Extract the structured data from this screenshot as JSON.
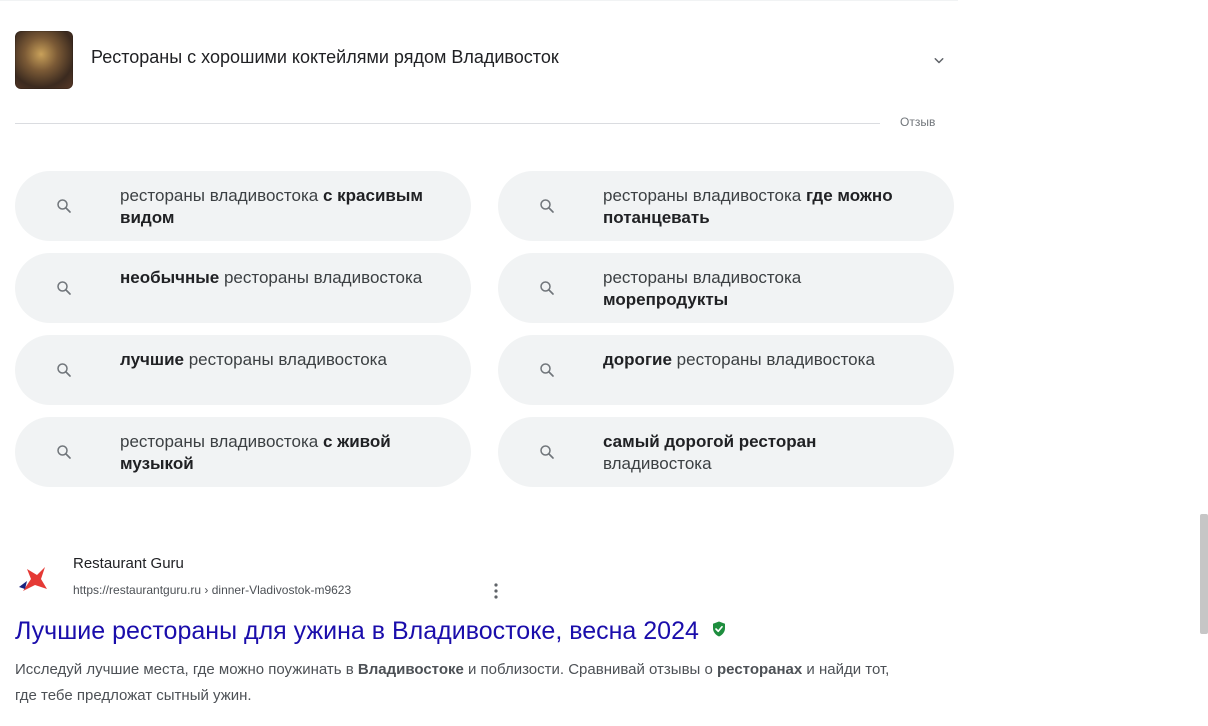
{
  "accordion": {
    "title": "Рестораны с хорошими коктейлями рядом Владивосток"
  },
  "feedback_label": "Отзыв",
  "related_searches": [
    {
      "parts": [
        {
          "text": "рестораны владивостока ",
          "bold": false
        },
        {
          "text": "с красивым видом",
          "bold": true
        }
      ]
    },
    {
      "parts": [
        {
          "text": "рестораны владивостока ",
          "bold": false
        },
        {
          "text": "где можно потанцевать",
          "bold": true
        }
      ]
    },
    {
      "parts": [
        {
          "text": "необычные",
          "bold": true
        },
        {
          "text": " рестораны владивостока",
          "bold": false
        }
      ]
    },
    {
      "parts": [
        {
          "text": "рестораны владивостока ",
          "bold": false
        },
        {
          "text": "морепродукты",
          "bold": true
        }
      ]
    },
    {
      "parts": [
        {
          "text": "лучшие",
          "bold": true
        },
        {
          "text": " рестораны владивостока",
          "bold": false
        }
      ]
    },
    {
      "parts": [
        {
          "text": "дорогие",
          "bold": true
        },
        {
          "text": " рестораны владивостока",
          "bold": false
        }
      ]
    },
    {
      "parts": [
        {
          "text": "рестораны владивостока ",
          "bold": false
        },
        {
          "text": "с живой музыкой",
          "bold": true
        }
      ]
    },
    {
      "parts": [
        {
          "text": "самый дорогой ресторан",
          "bold": true
        },
        {
          "text": " владивостока",
          "bold": false
        }
      ]
    }
  ],
  "result": {
    "site_name": "Restaurant Guru",
    "url": "https://restaurantguru.ru › dinner-Vladivostok-m9623",
    "title": "Лучшие рестораны для ужина в Владивостоке, весна 2024",
    "snippet_parts": [
      {
        "text": "Исследуй лучшие места, где можно поужинать в ",
        "bold": false
      },
      {
        "text": "Владивостоке",
        "bold": true
      },
      {
        "text": " и поблизости. Сравнивай отзывы о ",
        "bold": false
      },
      {
        "text": "ресторанах",
        "bold": true
      },
      {
        "text": " и найди тот, где тебе предложат сытный ужин.",
        "bold": false
      }
    ]
  },
  "colors": {
    "link": "#1a0dab",
    "chip_bg": "#f1f3f4",
    "verified": "#1e8e3e",
    "favicon_red": "#e53935"
  },
  "icons": {
    "chip": "search-icon",
    "accordion": "chevron-down-icon",
    "result_menu": "more-vert-icon",
    "verified": "verified-shield-icon"
  }
}
